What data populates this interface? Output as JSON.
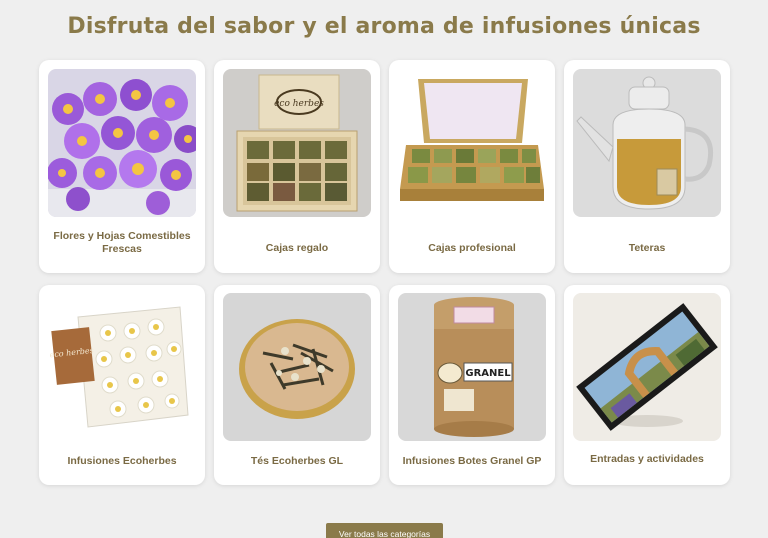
{
  "page": {
    "title": "Disfruta del sabor y el aroma de infusiones únicas"
  },
  "categories": [
    {
      "label": "Flores y Hojas Comestibles Frescas",
      "image_icon": "purple-flowers-image"
    },
    {
      "label": "Cajas regalo",
      "image_icon": "gift-box-image"
    },
    {
      "label": "Cajas profesional",
      "image_icon": "professional-box-image"
    },
    {
      "label": "Teteras",
      "image_icon": "teapot-image"
    },
    {
      "label": "Infusiones Ecoherbes",
      "image_icon": "chamomile-bag-image"
    },
    {
      "label": "Tés Ecoherbes GL",
      "image_icon": "tea-plate-image"
    },
    {
      "label": "Infusiones Botes Granel GP",
      "image_icon": "granel-jar-image"
    },
    {
      "label": "Entradas y actividades",
      "image_icon": "ticket-image"
    }
  ],
  "images": {
    "logo_text": "eco herbes",
    "granel_text": "GRANEL"
  },
  "cta": {
    "label": "Ver todas las categorías"
  },
  "colors": {
    "accent": "#8a7a4a",
    "background": "#efefef",
    "card": "#ffffff"
  }
}
